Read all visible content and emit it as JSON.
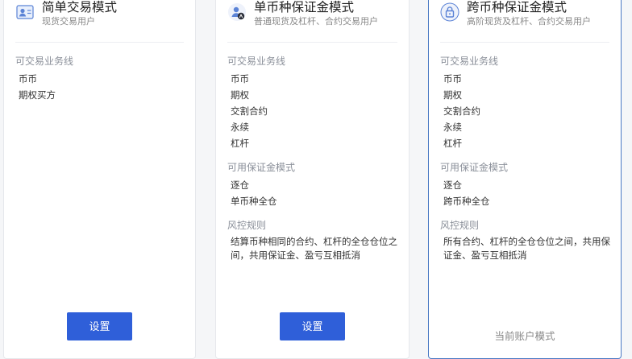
{
  "cards": [
    {
      "title": "简单交易模式",
      "subtitle": "现货交易用户",
      "sections": [
        {
          "title": "可交易业务线",
          "items": [
            "币币",
            "期权买方"
          ]
        }
      ],
      "button_label": "设置"
    },
    {
      "title": "单币种保证金模式",
      "subtitle": "普通现货及杠杆、合约交易用户",
      "sections": [
        {
          "title": "可交易业务线",
          "items": [
            "币币",
            "期权",
            "交割合约",
            "永续",
            "杠杆"
          ]
        },
        {
          "title": "可用保证金模式",
          "items": [
            "逐仓",
            "单币种全仓"
          ]
        },
        {
          "title": "风控规则",
          "text": "结算币种相同的合约、杠杆的全仓仓位之间，共用保证金、盈亏互相抵消"
        }
      ],
      "button_label": "设置"
    },
    {
      "title": "跨币种保证金模式",
      "subtitle": "高阶现货及杠杆、合约交易用户",
      "sections": [
        {
          "title": "可交易业务线",
          "items": [
            "币币",
            "期权",
            "交割合约",
            "永续",
            "杠杆"
          ]
        },
        {
          "title": "可用保证金模式",
          "items": [
            "逐仓",
            "跨币种全仓"
          ]
        },
        {
          "title": "风控规则",
          "text": "所有合约、杠杆的全仓仓位之间，共用保证金、盈亏互相抵消"
        }
      ],
      "status_label": "当前账户模式",
      "selected": true
    }
  ],
  "colors": {
    "accent": "#2f5fd9",
    "selected_border": "#4a79c4",
    "icon_blue": "#5b83d6"
  },
  "icons": [
    "user-card-icon",
    "user-badge-icon",
    "user-lock-icon"
  ]
}
